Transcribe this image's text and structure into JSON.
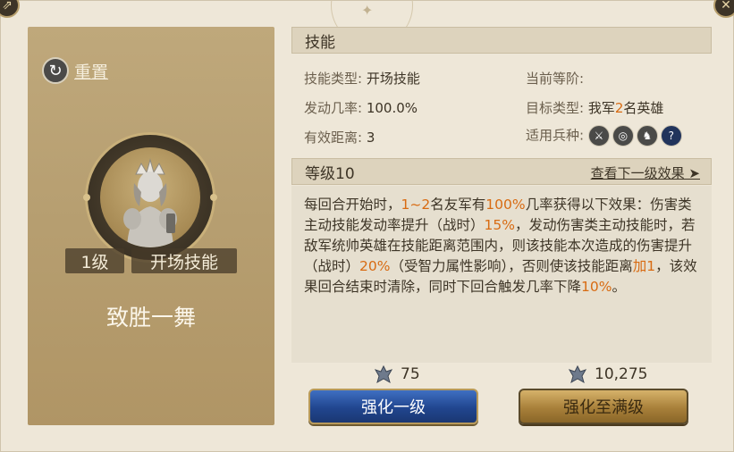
{
  "left": {
    "reset_label": "重置",
    "level_tag": "1级",
    "type_tag": "开场技能",
    "skill_name": "致胜一舞"
  },
  "skill_header": "技能",
  "info": {
    "type_key": "技能类型:",
    "type_val": "开场技能",
    "current_key": "当前等阶:",
    "current_val": "",
    "rate_key": "发动几率:",
    "rate_val": "100.0%",
    "target_key": "目标类型:",
    "target_pre": "我军",
    "target_num": "2",
    "target_post": "名英雄",
    "range_key": "有效距离:",
    "range_val": "3",
    "troops_key": "适用兵种:",
    "troop_icons": [
      "sword-icon",
      "target-icon",
      "horse-icon",
      "question-icon"
    ]
  },
  "level": {
    "label": "等级10",
    "next_link": "查看下一级效果 ➤"
  },
  "description": {
    "p1": "每回合开始时，",
    "h1": "1~2",
    "p2": "名友军有",
    "h2": "100%",
    "p3": "几率获得以下效果：伤害类主动技能发动率提升（战时）",
    "h3": "15%",
    "p4": "，发动伤害类主动技能时，若敌军统帅英雄在技能距离范围内，则该技能本次造成的伤害提升（战时）",
    "h4": "20%",
    "p5": "（受智力属性影响），否则使该技能距离",
    "h5": "加1",
    "p6": "，该效果回合结束时清除，同时下回合触发几率下降",
    "h6": "10%",
    "p7": "。"
  },
  "costs": {
    "one": "75",
    "max": "10,275"
  },
  "buttons": {
    "upgrade_one": "强化一级",
    "upgrade_max": "强化至满级"
  },
  "colors": {
    "highlight": "#d86b12",
    "card": "#b69e70",
    "blue_button": "#21468f",
    "gold_button": "#a8803a"
  }
}
